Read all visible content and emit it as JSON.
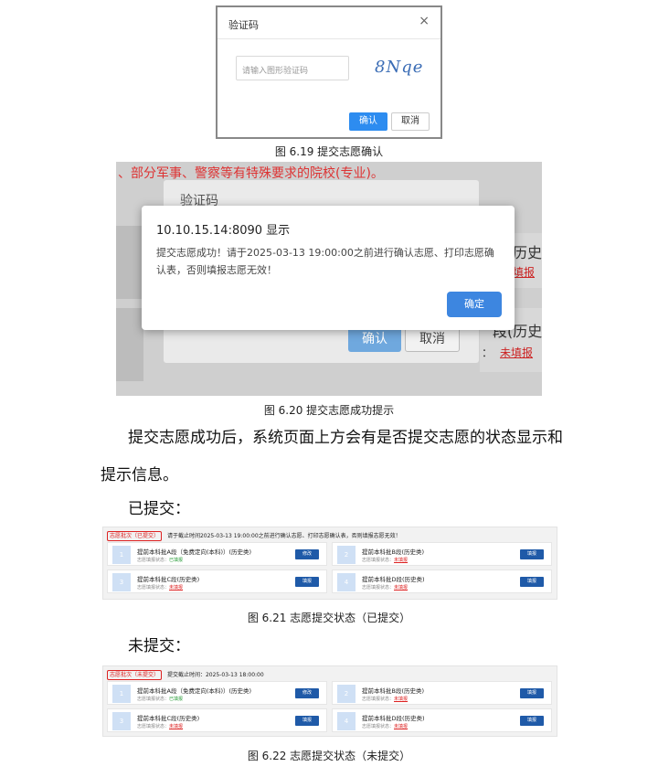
{
  "fig619": {
    "dialog_title": "验证码",
    "close_glyph": "×",
    "input_placeholder": "请输入图形验证码",
    "captcha_text": "8Nqe",
    "confirm_label": "确认",
    "cancel_label": "取消",
    "caption": "图 6.19  提交志愿确认"
  },
  "fig620": {
    "bg_banner": "、部分军事、警察等有特殊要求的院校(专业)。",
    "bg_dialog_title": "验证码",
    "bg_right_text_1": "历史",
    "bg_right_link_1": "填报",
    "bg_right_text_2": "段(历史",
    "bg_right_link_2_prefix": "：",
    "bg_right_link_2": "未填报",
    "bg_confirm_label": "确认",
    "bg_cancel_label": "取消",
    "alert_title": "10.10.15.14:8090 显示",
    "alert_message": "提交志愿成功！请于2025-03-13 19:00:00之前进行确认志愿、打印志愿确认表，否则填报志愿无效！",
    "alert_ok_label": "确定",
    "caption": "图 6.20  提交志愿成功提示"
  },
  "body_text": {
    "para_line1": "提交志愿成功后，系统页面上方会有是否提交志愿的状态显示和",
    "para_line2": "提示信息。",
    "submitted_heading": "已提交：",
    "unsubmitted_heading": "未提交："
  },
  "fig621": {
    "tag": "志愿批次（已提交）",
    "notice": "请于截止时间2025-03-13 19:00:00之前进行确认志愿、打印志愿确认表，否则填报志愿无效！",
    "cards": [
      {
        "num": "1",
        "name": "提前本科批A段（免费定向(本科)）(历史类)",
        "state_label": "志愿填报状态：",
        "state_value": "已填报",
        "state_type": "ok",
        "button": "修改"
      },
      {
        "num": "2",
        "name": "提前本科批B段(历史类)",
        "state_label": "志愿填报状态：",
        "state_value": "未填报",
        "state_type": "no",
        "button": "填报"
      },
      {
        "num": "3",
        "name": "提前本科批C段(历史类)",
        "state_label": "志愿填报状态：",
        "state_value": "未填报",
        "state_type": "no",
        "button": "填报"
      },
      {
        "num": "4",
        "name": "提前本科批D段(历史类)",
        "state_label": "志愿填报状态：",
        "state_value": "未填报",
        "state_type": "no",
        "button": "填报"
      }
    ],
    "caption": "图 6.21  志愿提交状态（已提交）"
  },
  "fig622": {
    "tag": "志愿批次（未提交）",
    "notice": "提交截止时间：2025-03-13 18:00:00",
    "cards": [
      {
        "num": "1",
        "name": "提前本科批A段（免费定向(本科)）(历史类)",
        "state_label": "志愿填报状态：",
        "state_value": "已填报",
        "state_type": "ok",
        "button": "修改"
      },
      {
        "num": "2",
        "name": "提前本科批B段(历史类)",
        "state_label": "志愿填报状态：",
        "state_value": "未填报",
        "state_type": "no",
        "button": "填报"
      },
      {
        "num": "3",
        "name": "提前本科批C段(历史类)",
        "state_label": "志愿填报状态：",
        "state_value": "未填报",
        "state_type": "no",
        "button": "填报"
      },
      {
        "num": "4",
        "name": "提前本科批D段(历史类)",
        "state_label": "志愿填报状态：",
        "state_value": "未填报",
        "state_type": "no",
        "button": "填报"
      }
    ],
    "caption": "图 6.22  志愿提交状态（未提交）"
  },
  "colors": {
    "primary_button": "#2d8cf0",
    "status_ok": "#2a9d3a",
    "status_no": "#d22",
    "action_button": "#1f5aa8"
  }
}
